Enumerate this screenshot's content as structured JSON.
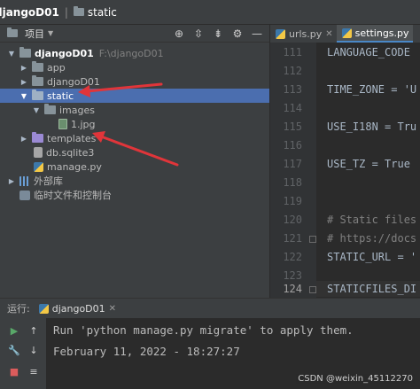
{
  "breadcrumb": {
    "project": "djangoD01",
    "folder": "static"
  },
  "project_panel": {
    "title": "项目",
    "toolbar_icons": [
      "locate-icon",
      "expand-all-icon",
      "collapse-all-icon",
      "gear-icon",
      "hide-icon"
    ],
    "tree": [
      {
        "label": "djangoD01",
        "hint": "F:\\djangoD01",
        "icon": "folder-icon",
        "expanded": true
      },
      {
        "label": "app",
        "icon": "folder-icon",
        "expanded": false
      },
      {
        "label": "djangoD01",
        "icon": "folder-icon",
        "expanded": false
      },
      {
        "label": "static",
        "icon": "folder-icon",
        "expanded": true,
        "selected": true
      },
      {
        "label": "images",
        "icon": "folder-icon",
        "expanded": true
      },
      {
        "label": "1.jpg",
        "icon": "image-file-icon"
      },
      {
        "label": "templates",
        "icon": "templates-folder-icon",
        "expanded": false
      },
      {
        "label": "db.sqlite3",
        "icon": "database-file-icon"
      },
      {
        "label": "manage.py",
        "icon": "python-file-icon"
      },
      {
        "label": "外部库",
        "icon": "libraries-icon",
        "expanded": false
      },
      {
        "label": "临时文件和控制台",
        "icon": "scratches-icon"
      }
    ]
  },
  "editor": {
    "tabs": [
      {
        "label": "urls.py",
        "active": false
      },
      {
        "label": "settings.py",
        "active": true
      }
    ],
    "lines": [
      {
        "num": "111",
        "text": "LANGUAGE_CODE"
      },
      {
        "num": "112",
        "text": ""
      },
      {
        "num": "113",
        "text": "TIME_ZONE = 'U"
      },
      {
        "num": "114",
        "text": ""
      },
      {
        "num": "115",
        "text": "USE_I18N = Tru"
      },
      {
        "num": "116",
        "text": ""
      },
      {
        "num": "117",
        "text": "USE_TZ = True"
      },
      {
        "num": "118",
        "text": ""
      },
      {
        "num": "119",
        "text": ""
      },
      {
        "num": "120",
        "text": "# Static files"
      },
      {
        "num": "121",
        "text": "# https://docs"
      },
      {
        "num": "122",
        "text": "STATIC_URL = '"
      },
      {
        "num": "123",
        "text": ""
      },
      {
        "num": "124",
        "text": "STATICFILES_DI"
      }
    ]
  },
  "run_panel": {
    "label": "运行:",
    "tab": "djangoD01",
    "console": [
      "Run 'python manage.py migrate' to apply them.",
      "February 11, 2022 - 18:27:27"
    ]
  },
  "watermark": "CSDN @weixin_45112270",
  "colors": {
    "selection": "#4b6eaf",
    "annotation_arrow": "#e0353a",
    "templates_folder": "#9b8ad4"
  }
}
